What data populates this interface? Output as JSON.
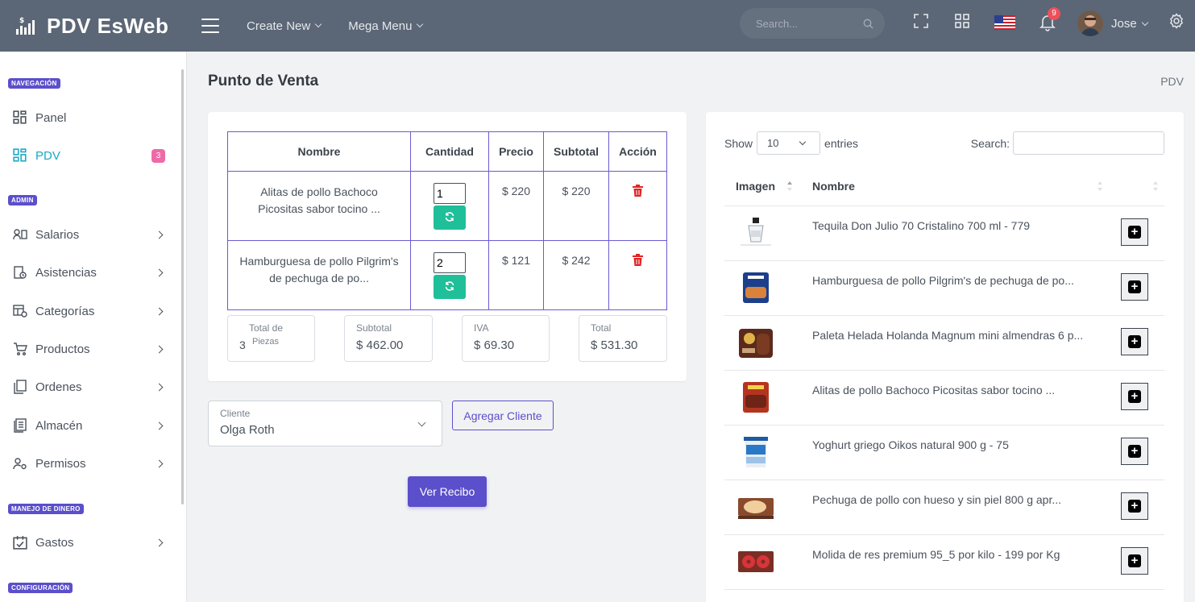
{
  "app": {
    "brand": "PDV EsWeb",
    "menu": [
      "Create New",
      "Mega Menu"
    ],
    "search_placeholder": "Search...",
    "notif_count": "9",
    "user_name": "Jose"
  },
  "sidebar": {
    "sections": [
      "NAVEGACIÓN",
      "ADMIN",
      "MANEJO DE DINERO",
      "CONFIGURACIÓN"
    ],
    "items": [
      {
        "label": "Panel",
        "icon": "dashboard-icon"
      },
      {
        "label": "PDV",
        "icon": "dashboard-icon",
        "badge": "3",
        "active": true
      },
      {
        "label": "Salarios",
        "icon": "salary-icon"
      },
      {
        "label": "Asistencias",
        "icon": "attendance-icon"
      },
      {
        "label": "Categorías",
        "icon": "categories-icon"
      },
      {
        "label": "Productos",
        "icon": "cart-icon"
      },
      {
        "label": "Ordenes",
        "icon": "orders-icon"
      },
      {
        "label": "Almacén",
        "icon": "warehouse-icon"
      },
      {
        "label": "Permisos",
        "icon": "permissions-icon"
      },
      {
        "label": "Gastos",
        "icon": "expenses-icon"
      }
    ]
  },
  "page": {
    "title": "Punto de Venta",
    "breadcrumb": "PDV"
  },
  "cart": {
    "headers": [
      "Nombre",
      "Cantidad",
      "Precio",
      "Subtotal",
      "Acción"
    ],
    "rows": [
      {
        "name": "Alitas de pollo Bachoco Picositas sabor tocino ...",
        "qty": "1",
        "price": "$ 220",
        "subtotal": "$ 220"
      },
      {
        "name": "Hamburguesa de pollo Pilgrim's de pechuga de po...",
        "qty": "2",
        "price": "$ 121",
        "subtotal": "$ 242"
      }
    ],
    "totals": {
      "pieces_label_1": "Total de",
      "pieces_label_2": "Piezas",
      "pieces": "3",
      "subtotal_label": "Subtotal",
      "subtotal": "$ 462.00",
      "iva_label": "IVA",
      "iva": "$ 69.30",
      "total_label": "Total",
      "total": "$ 531.30"
    }
  },
  "client": {
    "label": "Cliente",
    "value": "Olga Roth",
    "add_button": "Agregar Cliente",
    "receipt_button": "Ver Recibo"
  },
  "products": {
    "show_label": "Show",
    "page_size": "10",
    "entries_label": "entries",
    "search_label": "Search:",
    "col_image": "Imagen",
    "col_name": "Nombre",
    "rows": [
      {
        "name": "Tequila Don Julio 70 Cristalino 700 ml - 779"
      },
      {
        "name": "Hamburguesa de pollo Pilgrim's de pechuga de po..."
      },
      {
        "name": "Paleta Helada Holanda Magnum mini almendras 6 p..."
      },
      {
        "name": "Alitas de pollo Bachoco Picositas sabor tocino ..."
      },
      {
        "name": "Yoghurt griego Oikos natural 900 g - 75"
      },
      {
        "name": "Pechuga de pollo con hueso y sin piel 800 g apr..."
      },
      {
        "name": "Molida de res premium 95_5 por kilo - 199 por Kg"
      }
    ]
  },
  "colors": {
    "topbar": "#5b6676",
    "accent": "#5b4fcb",
    "active": "#18a9c6",
    "success": "#1fbf99",
    "danger": "#e02424"
  }
}
